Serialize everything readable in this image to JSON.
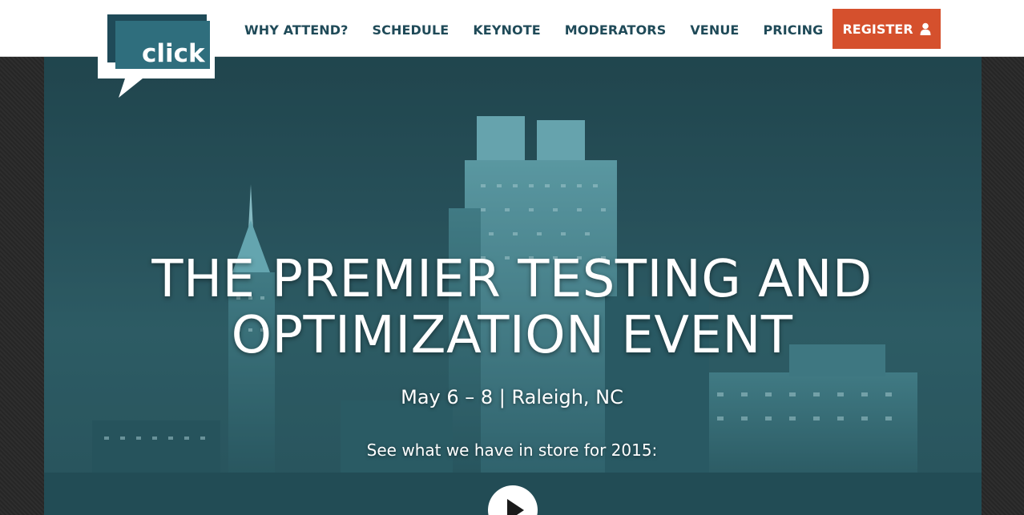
{
  "logo": {
    "text": "click"
  },
  "nav": {
    "items": [
      {
        "label": "WHY ATTEND?"
      },
      {
        "label": "SCHEDULE"
      },
      {
        "label": "KEYNOTE"
      },
      {
        "label": "MODERATORS"
      },
      {
        "label": "VENUE"
      },
      {
        "label": "PRICING"
      }
    ],
    "register_label": "REGISTER",
    "register_icon": "user-icon"
  },
  "hero": {
    "headline_line1": "THE PREMIER TESTING AND",
    "headline_line2": "OPTIMIZATION EVENT",
    "dates": "May 6 – 8 | Raleigh, NC",
    "store_text": "See what we have in store for 2015:",
    "play_icon": "play-icon"
  },
  "colors": {
    "nav_text": "#1f4a58",
    "register_bg": "#d5502d",
    "hero_tint": "#2b5660",
    "logo_dark": "#1f4a58",
    "logo_light": "#2f6e7d"
  }
}
